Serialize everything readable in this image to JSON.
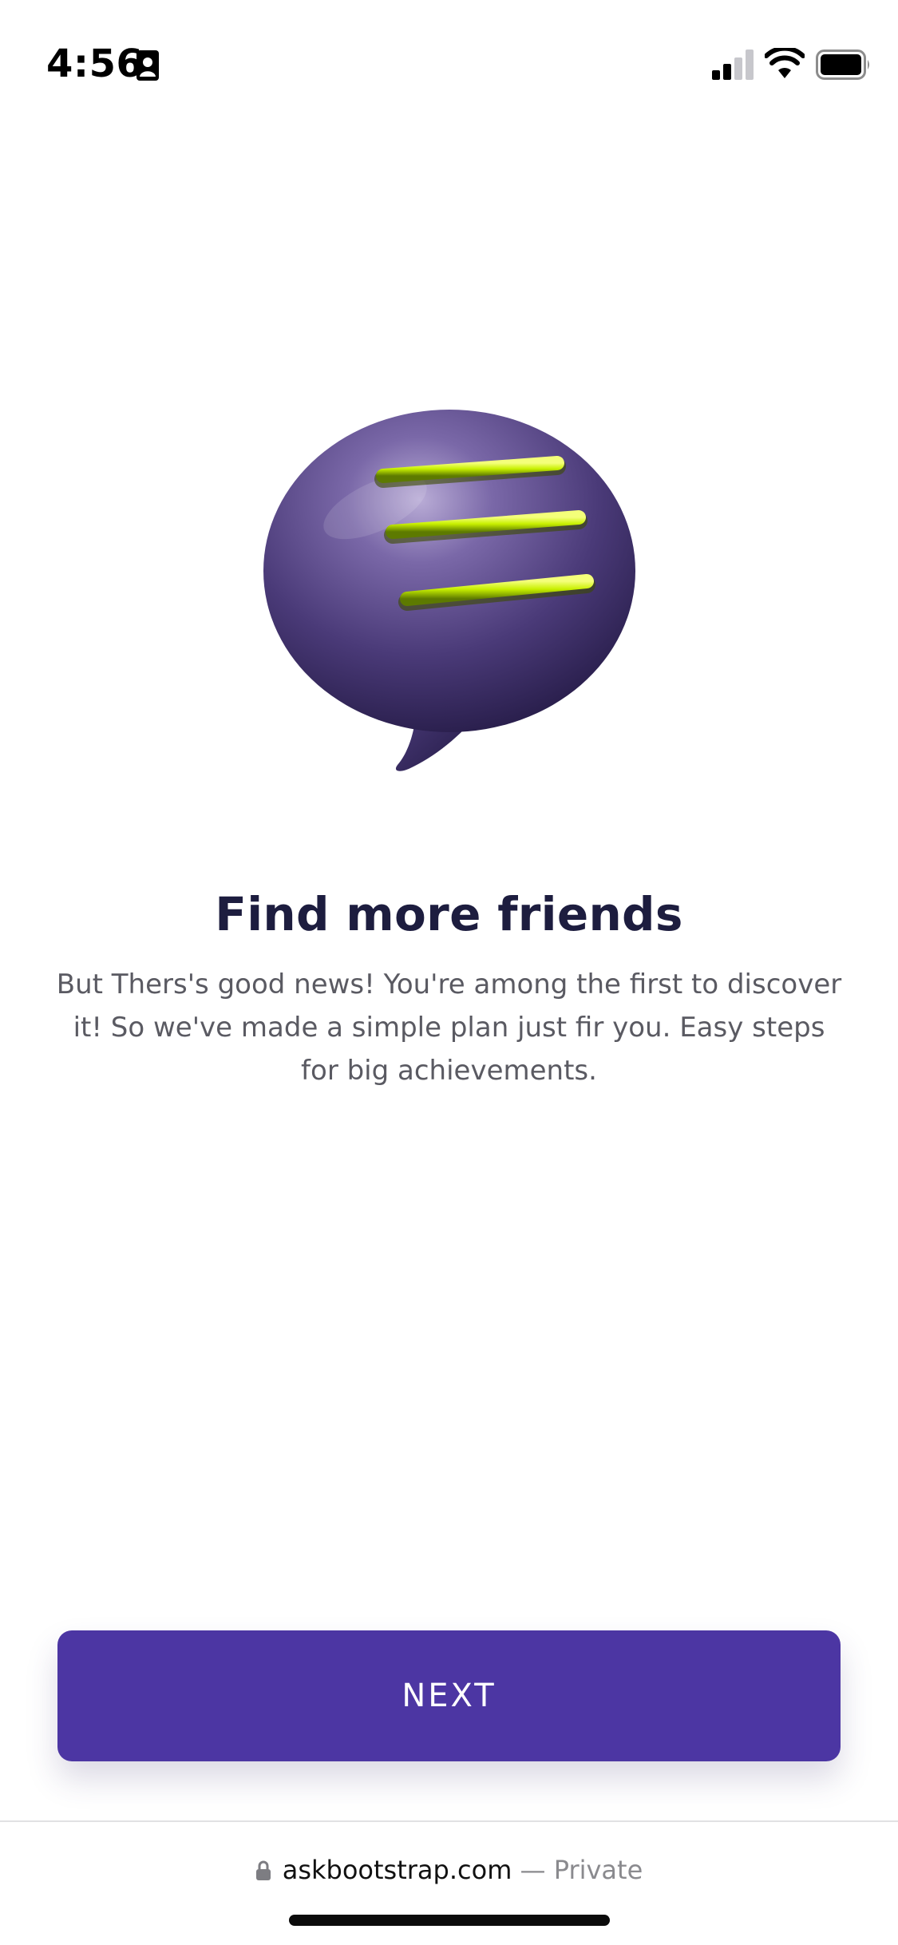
{
  "status_bar": {
    "time": "4:56",
    "icons": [
      "contact-card-icon",
      "signal-icon",
      "wifi-icon",
      "battery-icon"
    ]
  },
  "hero": {
    "illustration": "chat-bubble-icon",
    "colors": {
      "bubble": "#4a3a78",
      "lines": "#c8f000"
    }
  },
  "content": {
    "title": "Find more friends",
    "description": "But Thers's good news! You're among the first to discover it! So we've made a simple plan just fir you. Easy steps for big achievements."
  },
  "actions": {
    "next_label": "NEXT"
  },
  "browser": {
    "url": "askbootstrap.com",
    "separator": "—",
    "mode": "Private"
  },
  "theme": {
    "accent": "#4c36a3",
    "title_color": "#1d1d3f",
    "body_text": "#5a5a62"
  }
}
